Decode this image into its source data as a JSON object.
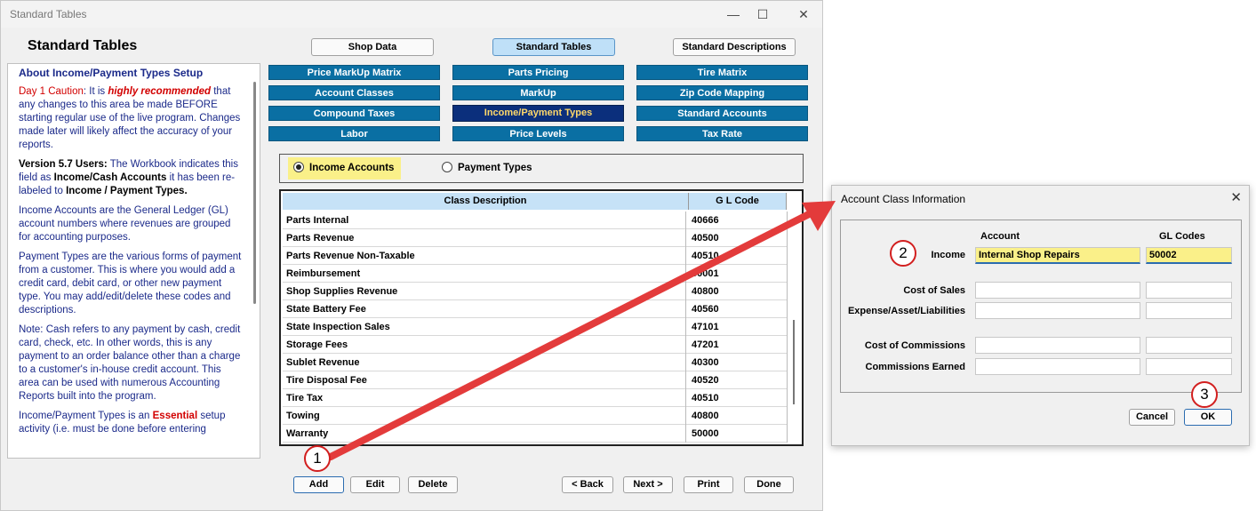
{
  "window": {
    "title": "Standard Tables",
    "app_title": "Standard Tables",
    "minimize": "—",
    "maximize": "☐",
    "close": "✕"
  },
  "top_tabs": [
    {
      "label": "Shop Data"
    },
    {
      "label": "Standard Tables",
      "active": true
    },
    {
      "label": "Standard Descriptions"
    }
  ],
  "nav_grid": [
    {
      "label": "Price MarkUp Matrix"
    },
    {
      "label": "Parts Pricing"
    },
    {
      "label": "Tire Matrix"
    },
    {
      "label": "Account Classes"
    },
    {
      "label": "MarkUp"
    },
    {
      "label": "Zip Code Mapping"
    },
    {
      "label": "Compound Taxes"
    },
    {
      "label": "Income/Payment Types",
      "selected": true
    },
    {
      "label": "Standard Accounts"
    },
    {
      "label": "Labor"
    },
    {
      "label": "Price Levels"
    },
    {
      "label": "Tax Rate"
    }
  ],
  "help": {
    "heading": "About Income/Payment Types Setup",
    "p1_label": "Day 1 Caution",
    "p1_a": ": It is ",
    "p1_em": "highly recommended",
    "p1_b": " that any changes to this area be made BEFORE starting regular use of the live program. Changes made later will likely affect the accuracy of your reports.",
    "p2_label": "Version 5.7 Users:",
    "p2_a": " The Workbook indicates this field as ",
    "p2_b1": "Income/Cash Accounts",
    "p2_c": " it has been re-labeled to ",
    "p2_b2": "Income / Payment Types.",
    "p3_label": "Income Accounts",
    "p3_text": " are the General Ledger (GL) account numbers where revenues are grouped for accounting purposes.",
    "p4_label": "Payment Types",
    "p4_text": " are the various forms of payment from a customer. This is where you would add a credit card, debit card, or other new payment type. You may add/edit/delete these codes and descriptions.",
    "p5_label": "Note:",
    "p5_text": " Cash refers to any payment by cash, credit card, check, etc. In other words, this is any payment to an order balance other than a charge to a customer's in-house credit account. This area can be used with numerous Accounting Reports built into the program.",
    "p6_a": "Income/Payment Types is an ",
    "p6_red": "Essential",
    "p6_b": " setup activity (i.e. must be done before entering"
  },
  "radio": {
    "income_label": "Income Accounts",
    "payment_label": "Payment Types",
    "selected": "income"
  },
  "table": {
    "headers": [
      "Class Description",
      "G L Code"
    ],
    "rows": [
      {
        "desc": "Parts Internal",
        "code": "40666"
      },
      {
        "desc": "Parts Revenue",
        "code": "40500"
      },
      {
        "desc": "Parts Revenue Non-Taxable",
        "code": "40510"
      },
      {
        "desc": "Reimbursement",
        "code": "50001"
      },
      {
        "desc": "Shop Supplies Revenue",
        "code": "40800"
      },
      {
        "desc": "State Battery Fee",
        "code": "40560"
      },
      {
        "desc": "State Inspection Sales",
        "code": "47101"
      },
      {
        "desc": "Storage Fees",
        "code": "47201"
      },
      {
        "desc": "Sublet Revenue",
        "code": "40300"
      },
      {
        "desc": "Tire Disposal Fee",
        "code": "40520"
      },
      {
        "desc": "Tire Tax",
        "code": "40510"
      },
      {
        "desc": "Towing",
        "code": "40800"
      },
      {
        "desc": "Warranty",
        "code": "50000"
      }
    ]
  },
  "bottom_buttons": {
    "add": "Add",
    "edit": "Edit",
    "delete": "Delete",
    "back": "< Back",
    "next": "Next >",
    "print": "Print",
    "done": "Done"
  },
  "dialog": {
    "title": "Account Class Information",
    "close": "✕",
    "col_account": "Account",
    "col_gl": "GL Codes",
    "income_label": "Income",
    "income_account": "Internal Shop Repairs",
    "income_gl": "50002",
    "cost_of_sales": "Cost of Sales",
    "expense": "Expense/Asset/Liabilities",
    "cost_of_commissions": "Cost of Commissions",
    "commissions_earned": "Commissions Earned",
    "cancel": "Cancel",
    "ok": "OK"
  },
  "callouts": [
    "1",
    "2",
    "3"
  ],
  "colors": {
    "nav_button": "#0a6fa3",
    "nav_selected": "#0b2f7c",
    "highlight": "#faf089",
    "callout_red": "#d21f1f",
    "arrow_red": "#e33b3b"
  }
}
